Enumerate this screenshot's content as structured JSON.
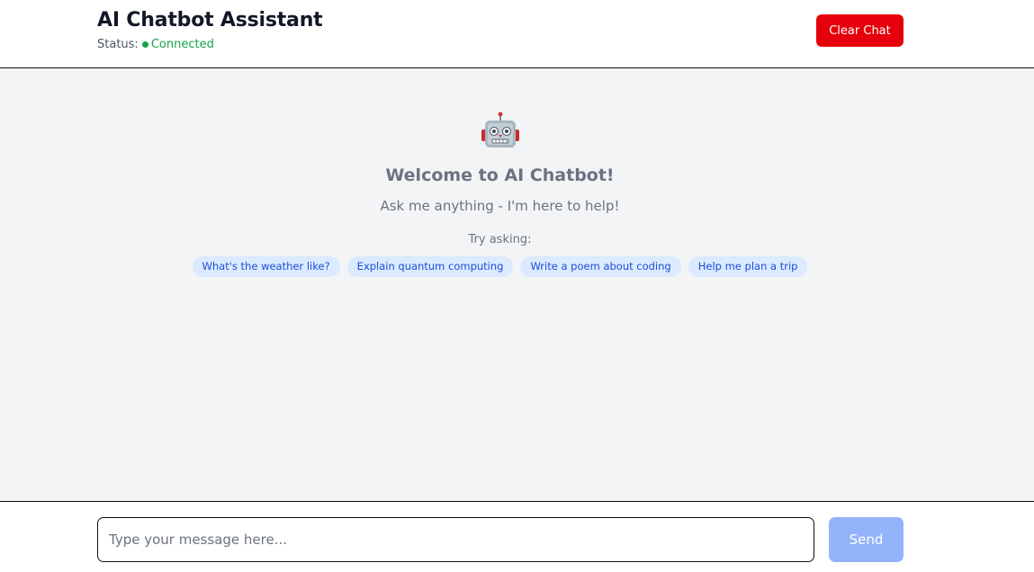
{
  "header": {
    "title": "AI Chatbot Assistant",
    "status_label": "Status:",
    "status_value": "Connected",
    "clear_button": "Clear Chat"
  },
  "welcome": {
    "icon": "robot-icon",
    "title": "Welcome to AI Chatbot!",
    "subtitle": "Ask me anything - I'm here to help!",
    "try_label": "Try asking:",
    "suggestions": [
      "What's the weather like?",
      "Explain quantum computing",
      "Write a poem about coding",
      "Help me plan a trip"
    ]
  },
  "composer": {
    "placeholder": "Type your message here...",
    "value": "",
    "send_label": "Send"
  },
  "colors": {
    "accent_red": "#e5000b",
    "status_green": "#16a34a",
    "chip_bg": "#dbeafe",
    "chip_text": "#1d4ed8",
    "send_disabled": "#93b4fb",
    "chat_bg": "#f3f4f6"
  }
}
